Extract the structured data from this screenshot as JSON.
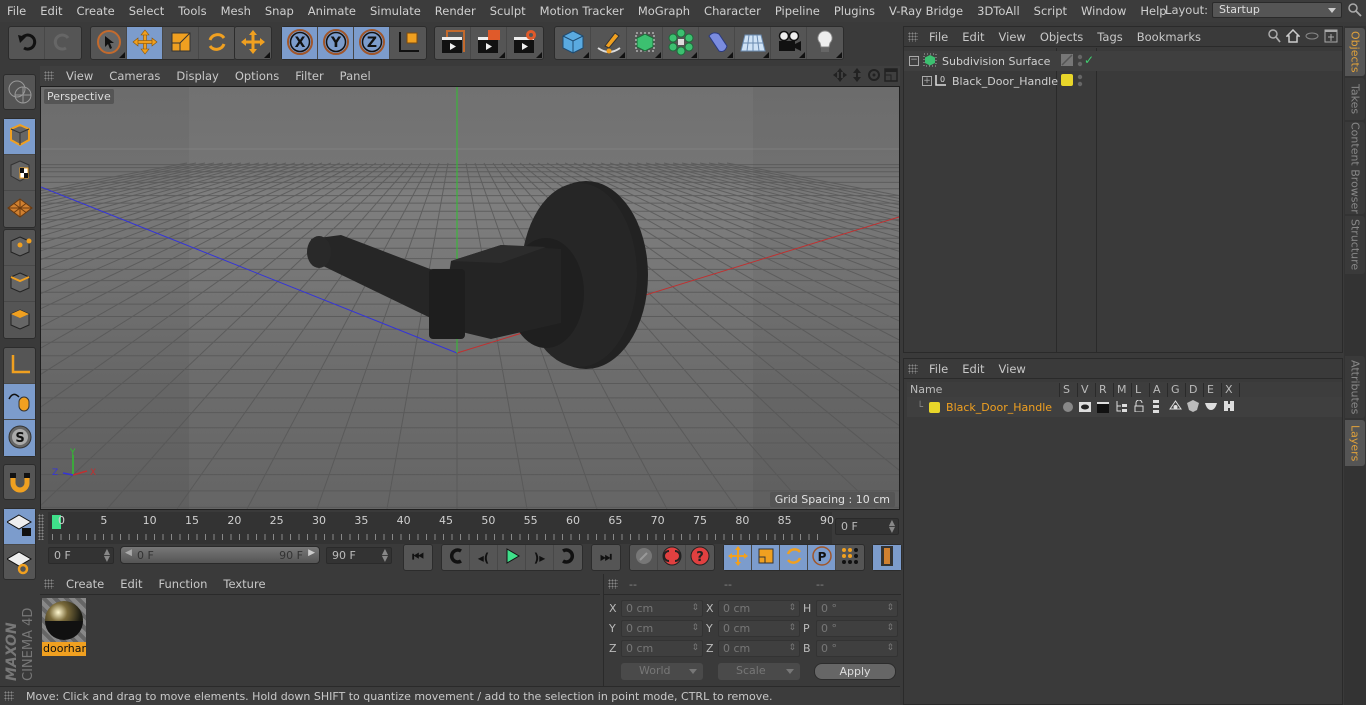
{
  "menubar": {
    "items": [
      "File",
      "Edit",
      "Create",
      "Select",
      "Tools",
      "Mesh",
      "Snap",
      "Animate",
      "Simulate",
      "Render",
      "Sculpt",
      "Motion Tracker",
      "MoGraph",
      "Character",
      "Pipeline",
      "Plugins",
      "V-Ray Bridge",
      "3DToAll",
      "Script",
      "Window",
      "Help"
    ],
    "layout_label": "Layout:",
    "layout_value": "Startup"
  },
  "toolbar": {
    "icons": [
      "undo-icon",
      "redo-icon",
      "live-selection-icon",
      "move-icon",
      "scale-icon",
      "rotate-icon",
      "recent-tool-icon",
      "x-axis-lock-icon",
      "y-axis-lock-icon",
      "z-axis-lock-icon",
      "coordinate-system-icon",
      "render-view-icon",
      "render-picture-viewer-icon",
      "render-settings-icon",
      "cube-primitive-icon",
      "pen-spline-icon",
      "subdivision-icon",
      "cloner-icon",
      "deformer-icon",
      "floor-scene-icon",
      "camera-icon",
      "light-icon"
    ]
  },
  "viewport": {
    "menu": [
      "View",
      "Cameras",
      "Display",
      "Options",
      "Filter",
      "Panel"
    ],
    "camera_label": "Perspective",
    "grid_spacing": "Grid Spacing : 10 cm",
    "axis_labels": {
      "x": "X",
      "y": "Y",
      "z": "Z"
    },
    "colors": {
      "x_axis": "#c0392b",
      "y_axis": "#2ecc40",
      "z_axis": "#3a3aff"
    }
  },
  "timeline": {
    "ticks": [
      "0",
      "5",
      "10",
      "15",
      "20",
      "25",
      "30",
      "35",
      "40",
      "45",
      "50",
      "55",
      "60",
      "65",
      "70",
      "75",
      "80",
      "85",
      "90"
    ],
    "current_frame": "0 F",
    "start_field": "0 F",
    "range_start": "0 F",
    "range_end": "90 F",
    "end_field": "90 F",
    "playhead_color": "#3fe08a"
  },
  "material_panel": {
    "menu": [
      "Create",
      "Edit",
      "Function",
      "Texture"
    ],
    "materials": [
      {
        "name": "doorhar"
      }
    ]
  },
  "coordinates": {
    "headers": [
      "--",
      "--",
      "--"
    ],
    "rows": [
      {
        "l1": "X",
        "v1": "0 cm",
        "l2": "X",
        "v2": "0 cm",
        "l3": "H",
        "v3": "0 °"
      },
      {
        "l1": "Y",
        "v1": "0 cm",
        "l2": "Y",
        "v2": "0 cm",
        "l3": "P",
        "v3": "0 °"
      },
      {
        "l1": "Z",
        "v1": "0 cm",
        "l2": "Z",
        "v2": "0 cm",
        "l3": "B",
        "v3": "0 °"
      }
    ],
    "mode": "World",
    "transform": "Scale",
    "apply_label": "Apply"
  },
  "status": "Move: Click and drag to move elements. Hold down SHIFT to quantize movement / add to the selection in point mode, CTRL to remove.",
  "objects_panel": {
    "menu": [
      "File",
      "Edit",
      "View",
      "Objects",
      "Tags",
      "Bookmarks"
    ],
    "objects": [
      {
        "name": "Subdivision Surface",
        "type": "subdivision"
      },
      {
        "name": "Black_Door_Handle",
        "type": "null"
      }
    ]
  },
  "layers_panel": {
    "menu": [
      "File",
      "Edit",
      "View"
    ],
    "columns": [
      "Name",
      "S",
      "V",
      "R",
      "M",
      "L",
      "A",
      "G",
      "D",
      "E",
      "X"
    ],
    "layers": [
      {
        "name": "Black_Door_Handle",
        "color": "#e8d62a"
      }
    ]
  },
  "right_tabs": [
    "Objects",
    "Takes",
    "Content Browser",
    "Structure",
    "Attributes",
    "Layers"
  ],
  "brand": {
    "maxon": "MAXON",
    "product": "CINEMA 4D"
  }
}
